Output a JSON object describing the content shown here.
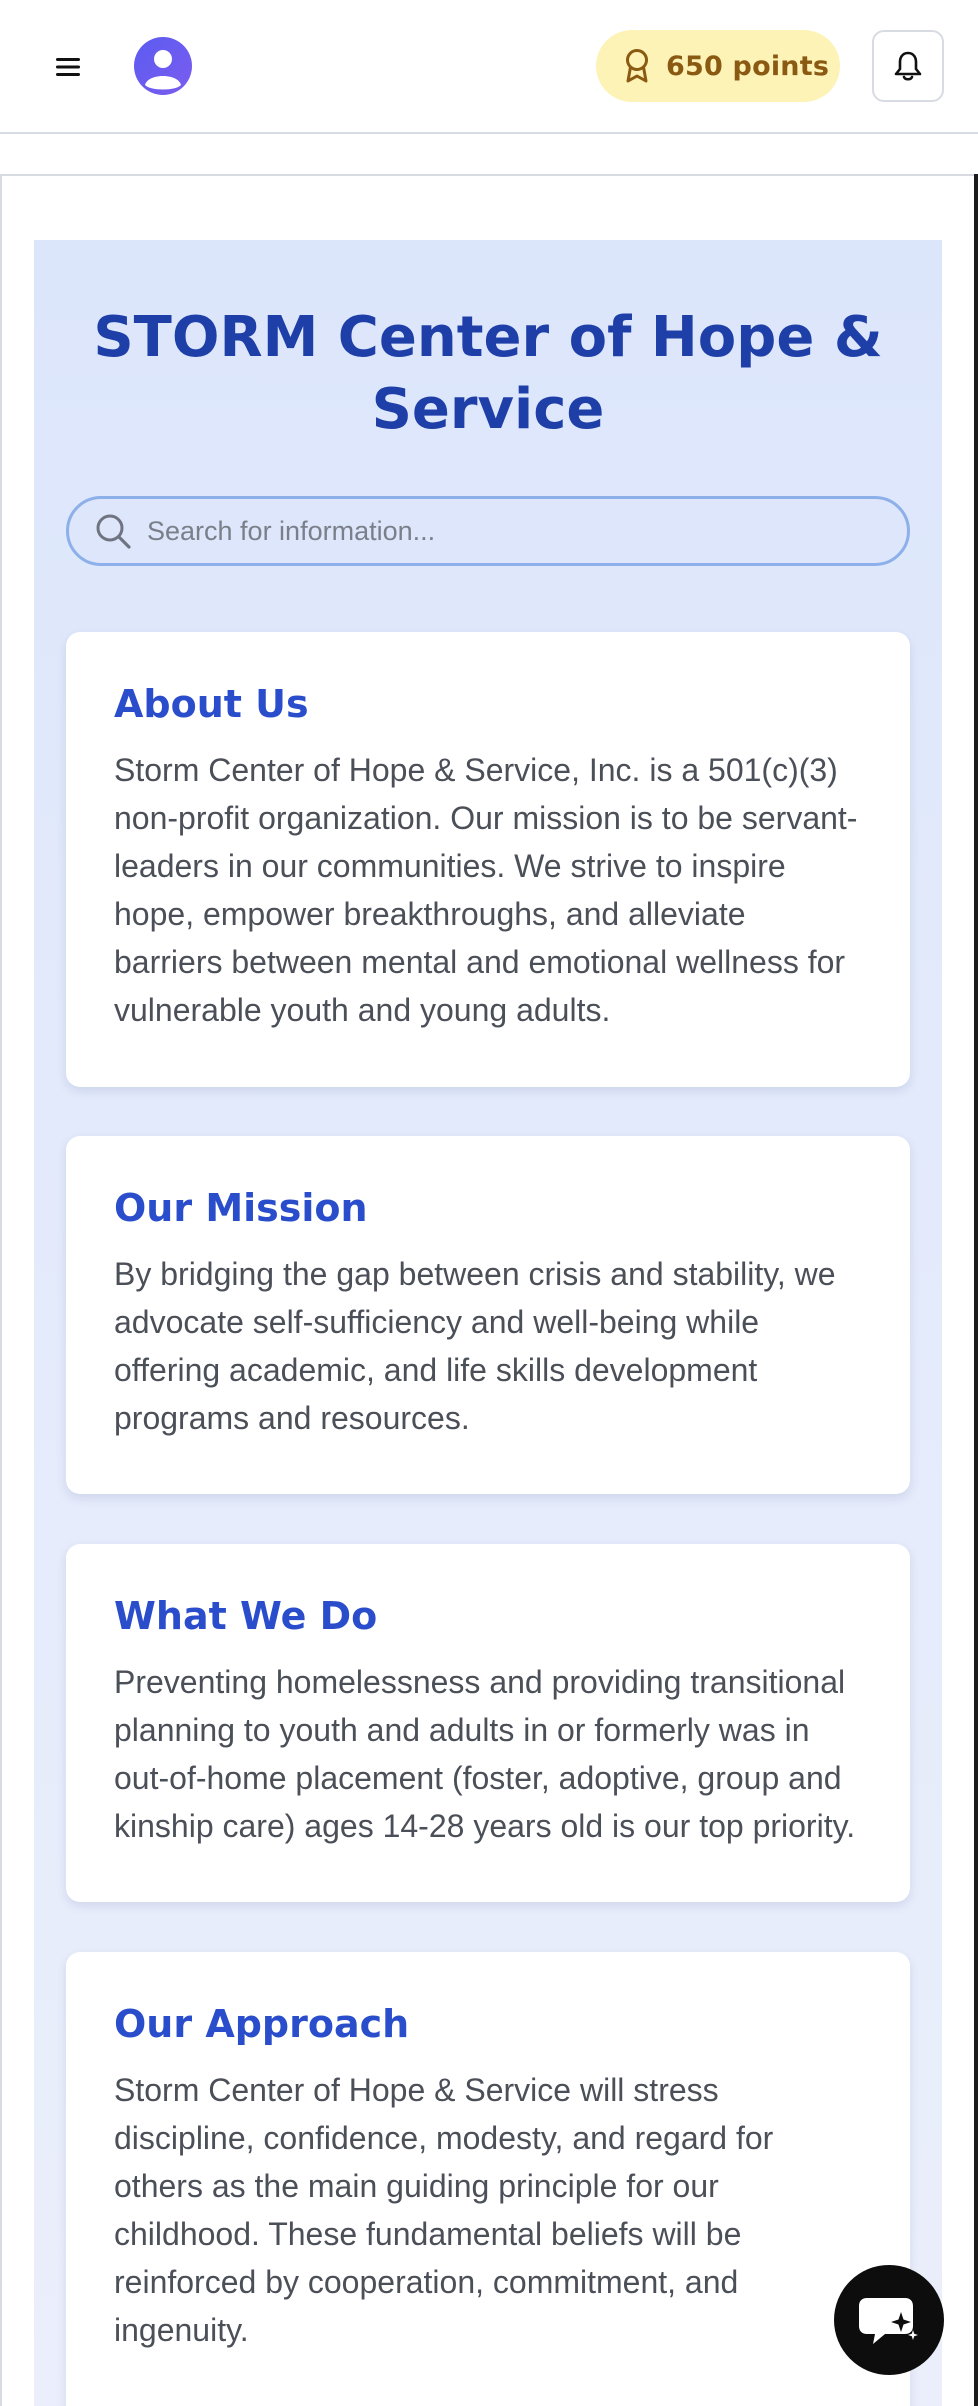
{
  "header": {
    "menu_icon": "hamburger-menu-icon",
    "avatar_icon": "user-avatar-icon",
    "points_label": "650 points",
    "points_color": "#fdf3b6",
    "award_icon": "award-ribbon-icon",
    "bell_icon": "bell-icon"
  },
  "main": {
    "title": "STORM Center of Hope & Service",
    "search": {
      "placeholder": "Search for information...",
      "value": "",
      "icon": "search-icon"
    },
    "cards": [
      {
        "heading": "About Us",
        "body": "Storm Center of Hope & Service, Inc. is a 501(c)(3) non-profit organization. Our mission is to be servant-leaders in our communities. We strive to inspire hope, empower breakthroughs, and alleviate barriers between mental and emotional wellness for vulnerable youth and young adults."
      },
      {
        "heading": "Our Mission",
        "body": "By bridging the gap between crisis and stability, we advocate self-sufficiency and well-being while offering academic, and life skills development programs and resources."
      },
      {
        "heading": "What We Do",
        "body": "Preventing homelessness and providing transitional planning to youth and adults in or formerly was in out-of-home placement (foster, adoptive, group and kinship care) ages 14-28 years old is our top priority."
      },
      {
        "heading": "Our Approach",
        "body": "Storm Center of Hope & Service will stress discipline, confidence, modesty, and regard for others as the main guiding principle for our childhood. These fundamental beliefs will be reinforced by cooperation, commitment, and ingenuity."
      }
    ]
  },
  "chat": {
    "icon": "chat-sparkle-icon"
  },
  "colors": {
    "title": "#1f3fa8",
    "card_heading": "#2a4ecb",
    "panel_bg": "#dce6fb"
  }
}
